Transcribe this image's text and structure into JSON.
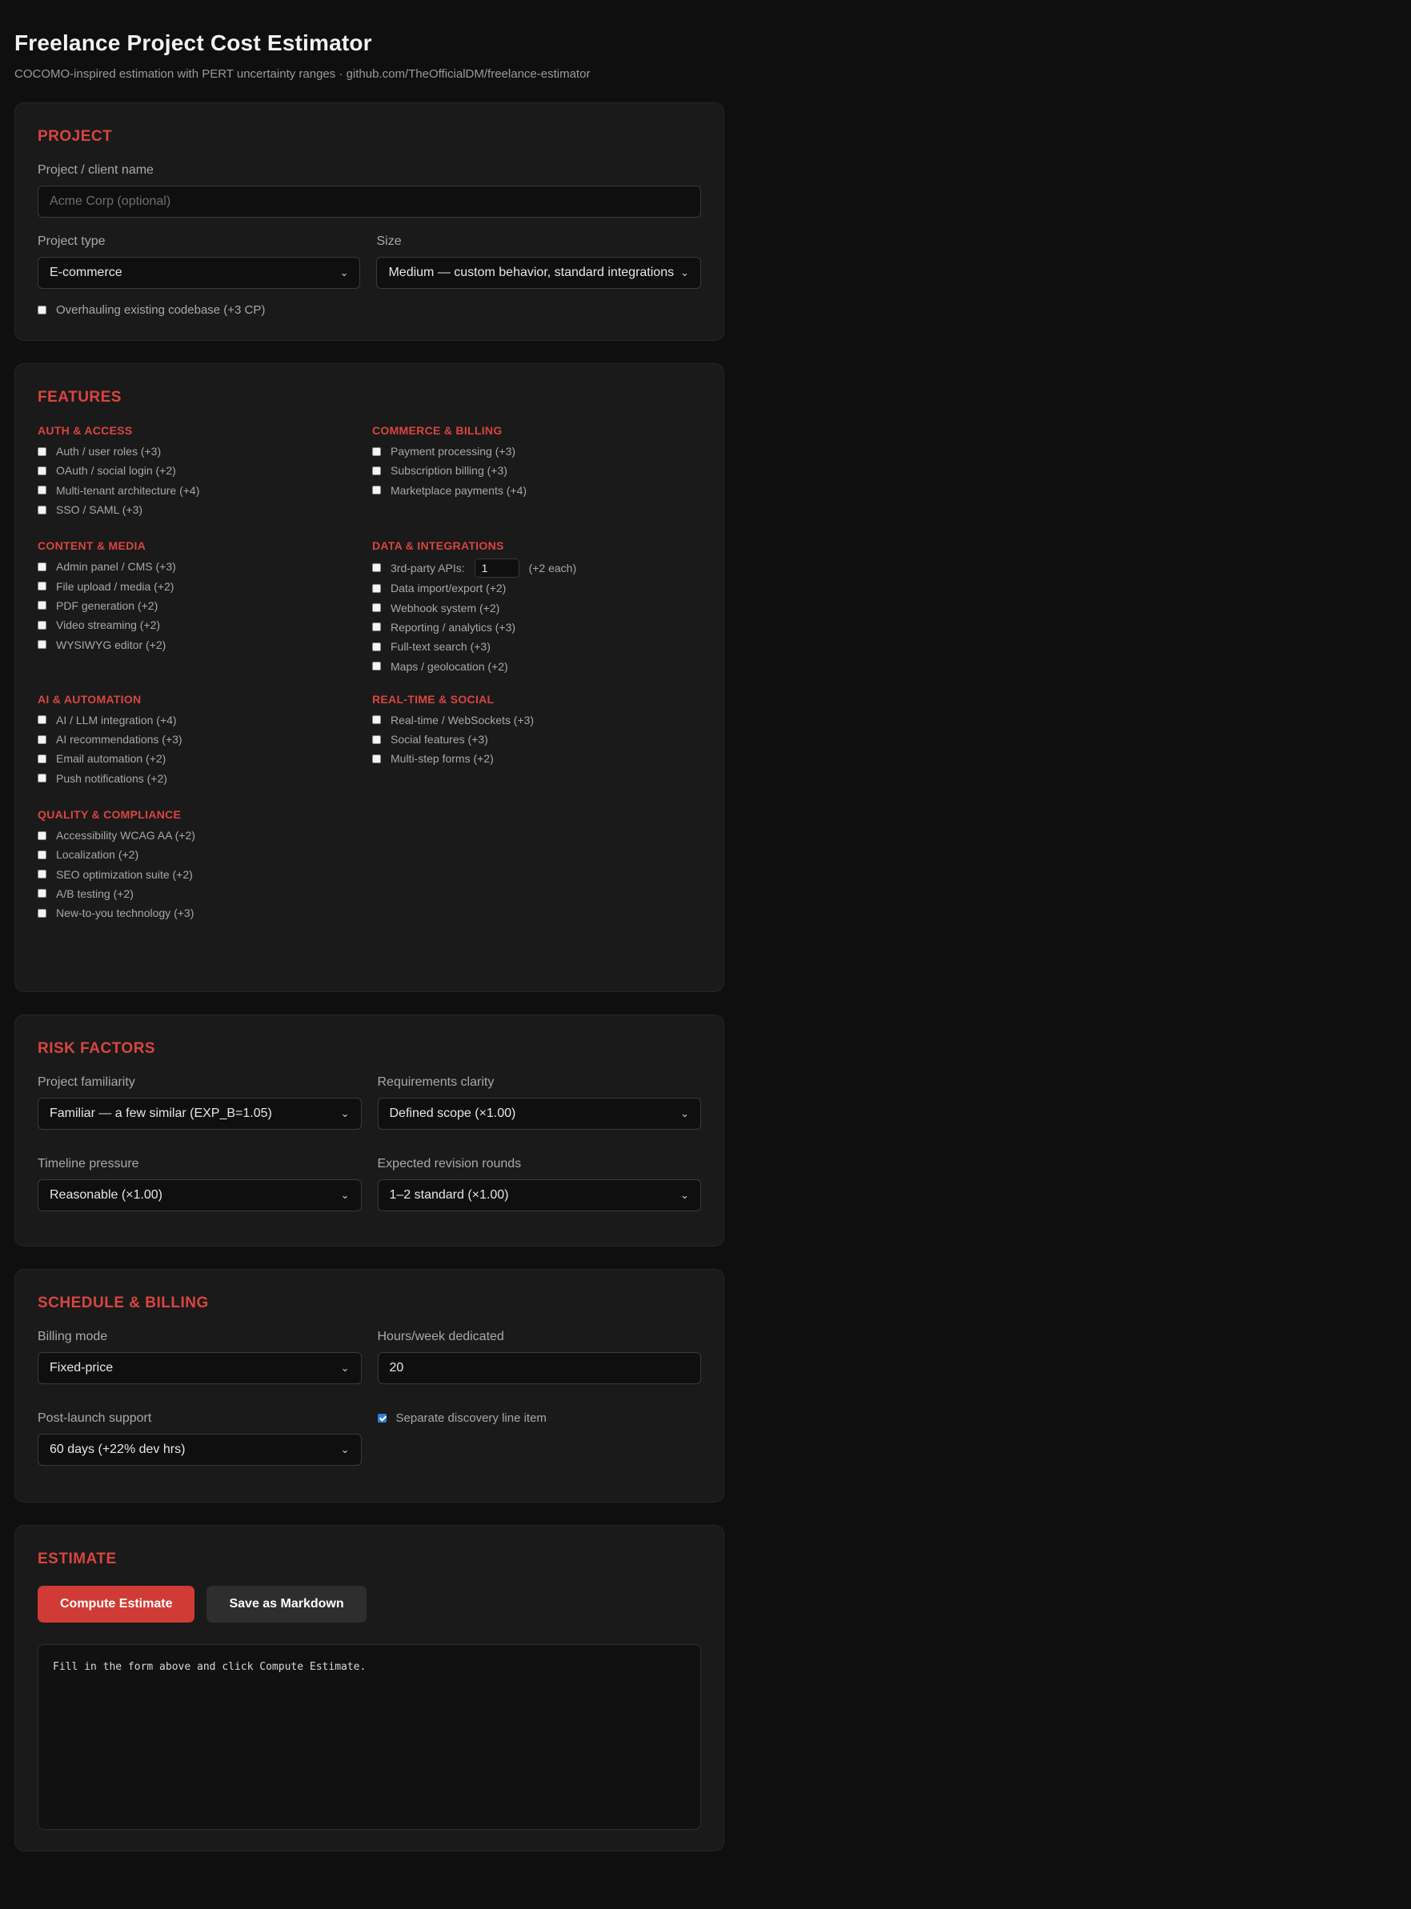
{
  "header": {
    "title": "Freelance Project Cost Estimator",
    "subtitle": "COCOMO-inspired estimation with PERT uncertainty ranges · github.com/TheOfficialDM/freelance-estimator"
  },
  "project": {
    "section_title": "PROJECT",
    "name_label": "Project / client name",
    "name_placeholder": "Acme Corp (optional)",
    "type_label": "Project type",
    "type_value": "E-commerce",
    "size_label": "Size",
    "size_value": "Medium — custom behavior, standard integrations",
    "overhaul_label": "Overhauling existing codebase (+3 CP)",
    "overhaul_checked": false
  },
  "features": {
    "section_title": "FEATURES",
    "groups": {
      "auth": {
        "title": "AUTH & ACCESS",
        "items": [
          "Auth / user roles (+3)",
          "OAuth / social login (+2)",
          "Multi-tenant architecture (+4)",
          "SSO / SAML (+3)"
        ]
      },
      "commerce": {
        "title": "COMMERCE & BILLING",
        "items": [
          "Payment processing (+3)",
          "Subscription billing (+3)",
          "Marketplace payments (+4)"
        ]
      },
      "content": {
        "title": "CONTENT & MEDIA",
        "items": [
          "Admin panel / CMS (+3)",
          "File upload / media (+2)",
          "PDF generation (+2)",
          "Video streaming (+2)",
          "WYSIWYG editor (+2)"
        ]
      },
      "data": {
        "title": "DATA & INTEGRATIONS",
        "api_label": "3rd-party APIs:",
        "api_count": "1",
        "api_suffix": "(+2 each)",
        "items": [
          "Data import/export (+2)",
          "Webhook system (+2)",
          "Reporting / analytics (+3)",
          "Full-text search (+3)",
          "Maps / geolocation (+2)"
        ]
      },
      "ai": {
        "title": "AI & AUTOMATION",
        "items": [
          "AI / LLM integration (+4)",
          "AI recommendations (+3)",
          "Email automation (+2)",
          "Push notifications (+2)"
        ]
      },
      "realtime": {
        "title": "REAL-TIME & SOCIAL",
        "items": [
          "Real-time / WebSockets (+3)",
          "Social features (+3)",
          "Multi-step forms (+2)"
        ]
      },
      "quality": {
        "title": "QUALITY & COMPLIANCE",
        "items": [
          "Accessibility WCAG AA (+2)",
          "Localization (+2)",
          "SEO optimization suite (+2)",
          "A/B testing (+2)",
          "New-to-you technology (+3)"
        ]
      }
    }
  },
  "risk": {
    "section_title": "RISK FACTORS",
    "familiarity_label": "Project familiarity",
    "familiarity_value": "Familiar — a few similar (EXP_B=1.05)",
    "clarity_label": "Requirements clarity",
    "clarity_value": "Defined scope (×1.00)",
    "timeline_label": "Timeline pressure",
    "timeline_value": "Reasonable (×1.00)",
    "revisions_label": "Expected revision rounds",
    "revisions_value": "1–2 standard (×1.00)"
  },
  "schedule": {
    "section_title": "SCHEDULE & BILLING",
    "billing_label": "Billing mode",
    "billing_value": "Fixed-price",
    "hours_label": "Hours/week dedicated",
    "hours_value": "20",
    "support_label": "Post-launch support",
    "support_value": "60 days (+22% dev hrs)",
    "discovery_label": "Separate discovery line item",
    "discovery_checked": true
  },
  "estimate": {
    "section_title": "ESTIMATE",
    "compute_label": "Compute Estimate",
    "save_label": "Save as Markdown",
    "output_text": "Fill in the form above and click Compute Estimate."
  },
  "colors": {
    "background": "#0f0f0f",
    "card": "#1a1a1a",
    "accent": "#d9453f",
    "checkbox_checked": "#2f7fd8"
  }
}
